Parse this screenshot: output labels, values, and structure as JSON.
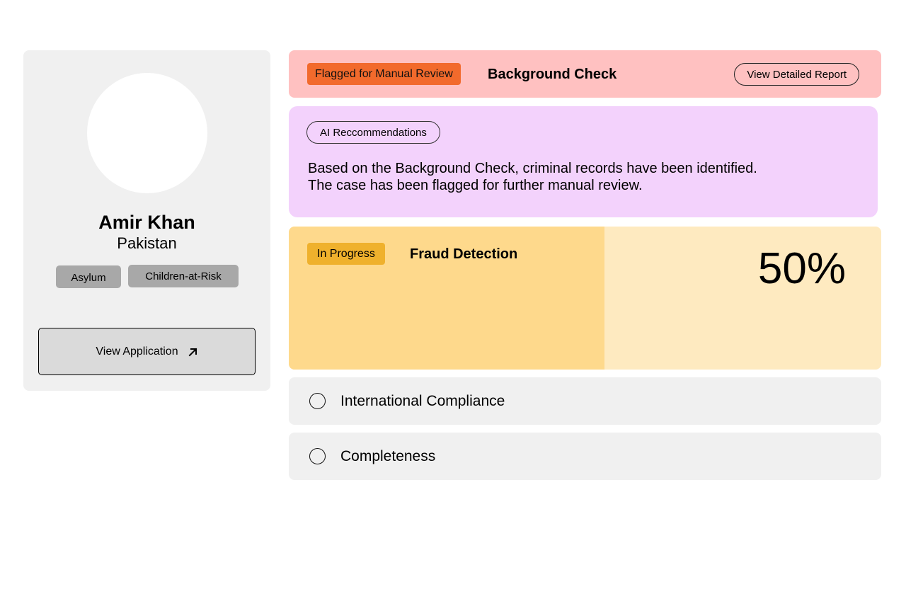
{
  "profile": {
    "name": "Amir Khan",
    "country": "Pakistan",
    "tags": [
      "Asylum",
      "Children-at-Risk"
    ],
    "view_application_label": "View Application"
  },
  "background_check": {
    "status": "Flagged for Manual Review",
    "title": "Background Check",
    "report_button": "View Detailed Report",
    "colors": {
      "panel": "#ffc1c1",
      "badge": "#f26a2c"
    }
  },
  "ai_recommendations": {
    "label": "AI Reccommendations",
    "text": "Based on the Background Check, criminal records have been identified. The case has been flagged for further manual review.",
    "colors": {
      "panel": "#f3d2fc"
    }
  },
  "fraud_detection": {
    "status": "In Progress",
    "title": "Fraud Detection",
    "percent_label": "50%",
    "progress": 0.5333,
    "colors": {
      "panel": "#feeac0",
      "fill": "#fed98c",
      "badge": "#efb12d"
    }
  },
  "checks": [
    {
      "label": "International Compliance",
      "checked": false
    },
    {
      "label": "Completeness",
      "checked": false
    }
  ]
}
